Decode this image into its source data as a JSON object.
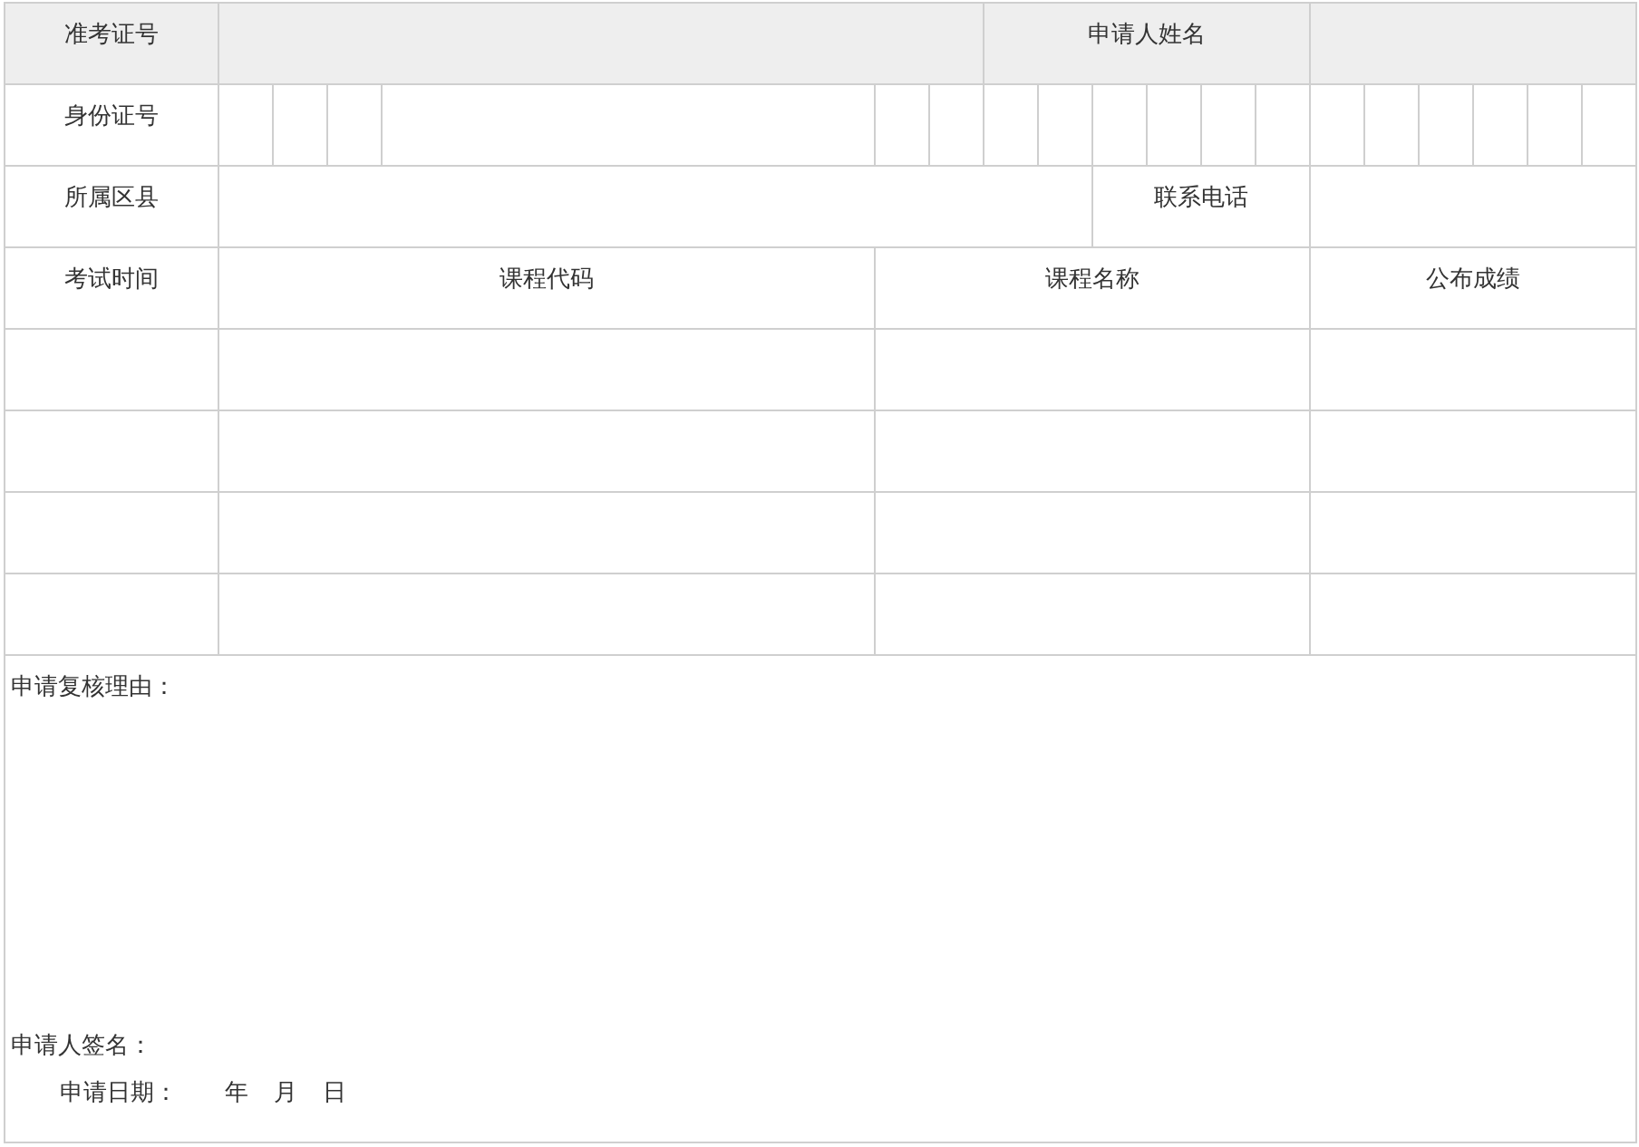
{
  "form": {
    "exam_number_label": "准考证号",
    "applicant_name_label": "申请人姓名",
    "id_number_label": "身份证号",
    "district_label": "所属区县",
    "phone_label": "联系电话"
  },
  "courses": {
    "columns": [
      "考试时间",
      "课程代码",
      "课程名称",
      "公布成绩"
    ]
  },
  "reason": {
    "label": "申请复核理由：",
    "signature_label": "申请人签名：",
    "date_label": "申请日期：",
    "year": "年",
    "month": "月",
    "day": "日"
  }
}
